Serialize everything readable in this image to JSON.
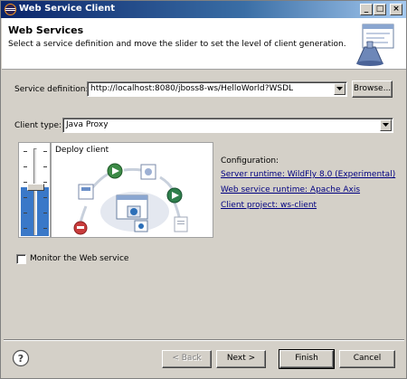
{
  "window": {
    "title": "Web Service Client",
    "minimize_glyph": "_",
    "maximize_glyph": "□",
    "close_glyph": "×"
  },
  "banner": {
    "title": "Web Services",
    "description": "Select a service definition and move the slider to set the level of client generation."
  },
  "service_definition": {
    "label": "Service definition:",
    "value": "http://localhost:8080/jboss8-ws/HelloWorld?WSDL",
    "browse_label": "Browse..."
  },
  "client_type": {
    "label": "Client type:",
    "value": "Java Proxy"
  },
  "slider": {
    "level_fraction": 0.55
  },
  "deploy": {
    "label": "Deploy client"
  },
  "configuration": {
    "heading": "Configuration:",
    "server_runtime": "Server runtime: WildFly 8.0 (Experimental)",
    "ws_runtime": "Web service runtime: Apache Axis",
    "client_project": "Client project: ws-client"
  },
  "monitor": {
    "label": "Monitor the Web service",
    "checked": false
  },
  "footer": {
    "help_glyph": "?",
    "back_label": "< Back",
    "next_label": "Next >",
    "finish_label": "Finish",
    "cancel_label": "Cancel"
  },
  "colors": {
    "title_bar": "#0a246a",
    "slider_fill": "#3a78c8",
    "link": "#000080",
    "dialog_bg": "#d4d0c8"
  }
}
